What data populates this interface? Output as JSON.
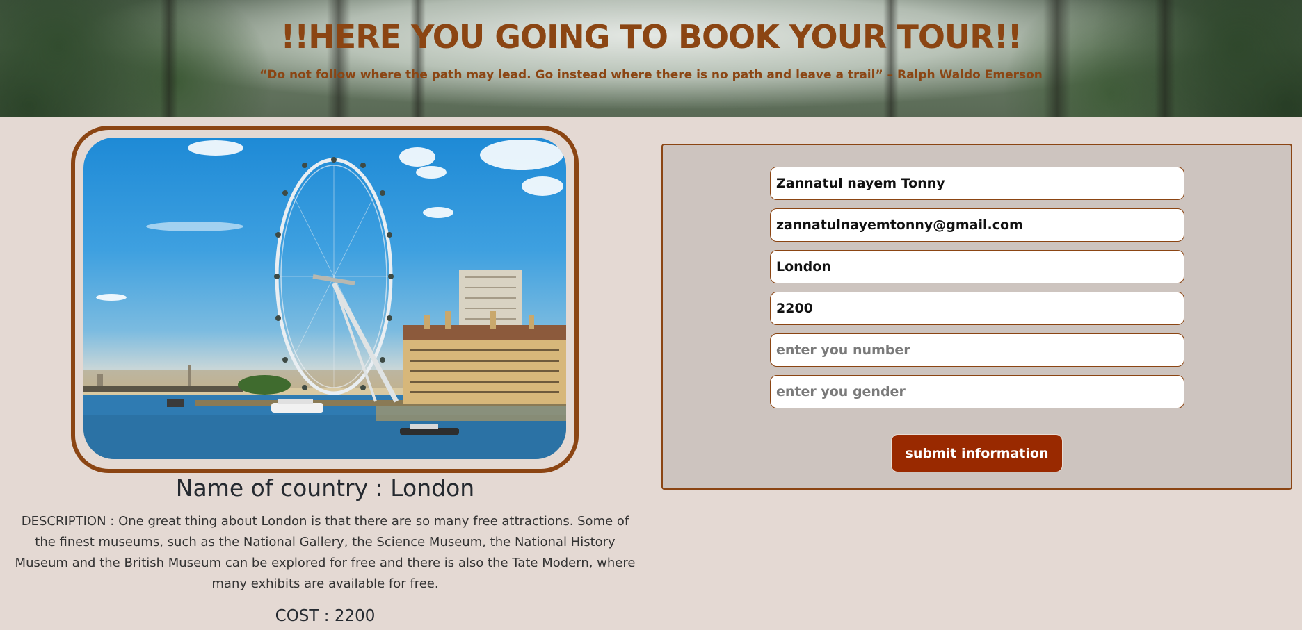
{
  "hero": {
    "title": "!!HERE YOU GOING TO BOOK YOUR TOUR!!",
    "quote": "“Do not follow where the path may lead. Go instead where there is no path and leave a trail” – Ralph Waldo Emerson"
  },
  "destination": {
    "image_alt": "London Eye beside the River Thames",
    "name_heading": "Name of country : London",
    "description": "DESCRIPTION : One great thing about London is that there are so many free attractions. Some of the finest museums, such as the National Gallery, the Science Museum, the National History Museum and the British Museum can be explored for free and there is also the Tate Modern, where many exhibits are available for free.",
    "cost": "COST : 2200"
  },
  "form": {
    "fields": [
      {
        "name": "name-field",
        "value": "Zannatul nayem Tonny",
        "placeholder": ""
      },
      {
        "name": "email-field",
        "value": "zannatulnayemtonny@gmail.com",
        "placeholder": ""
      },
      {
        "name": "place-field",
        "value": "London",
        "placeholder": ""
      },
      {
        "name": "cost-field",
        "value": "2200",
        "placeholder": ""
      },
      {
        "name": "number-field",
        "value": "",
        "placeholder": "enter you number"
      },
      {
        "name": "gender-field",
        "value": "",
        "placeholder": "enter you gender"
      }
    ],
    "submit_label": "submit information"
  },
  "colors": {
    "accent_brown": "#8b4513",
    "button_red": "#992900",
    "page_bg": "#e4d9d3",
    "panel_bg": "#cdc4bf"
  }
}
